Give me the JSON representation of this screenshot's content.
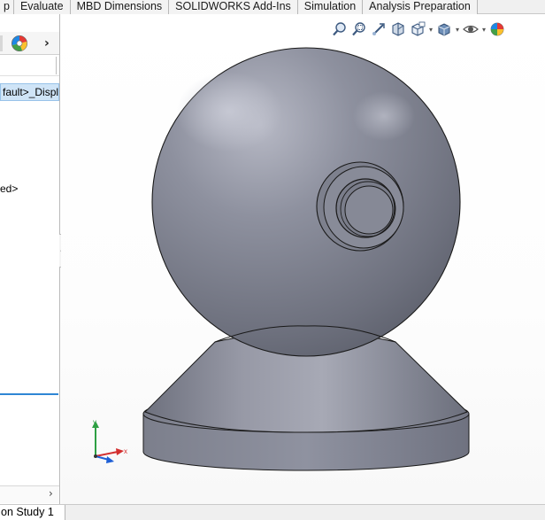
{
  "ribbon": {
    "tabs": [
      "p",
      "Evaluate",
      "MBD Dimensions",
      "SOLIDWORKS Add-Ins",
      "Simulation",
      "Analysis Preparation"
    ]
  },
  "feature_manager": {
    "config_label": "fault>_Displa",
    "item_text": "ed>",
    "scroll_right_arrow": "›",
    "tabs_expand": "›"
  },
  "heads_up_toolbar": {
    "icons": [
      "zoom-to-fit-icon",
      "zoom-to-area-icon",
      "previous-view-icon",
      "section-view-icon",
      "view-orientation-icon",
      "display-style-icon",
      "hide-show-items-icon",
      "edit-appearance-icon"
    ]
  },
  "triad": {
    "x_label": "x",
    "y_label": "y"
  },
  "bottom_tabs": {
    "study_tab": "on Study 1"
  },
  "colors": {
    "model_gray": "#8a8d9a",
    "selection_blue": "#cfe4f7",
    "accent_blue": "#2f86d4"
  }
}
